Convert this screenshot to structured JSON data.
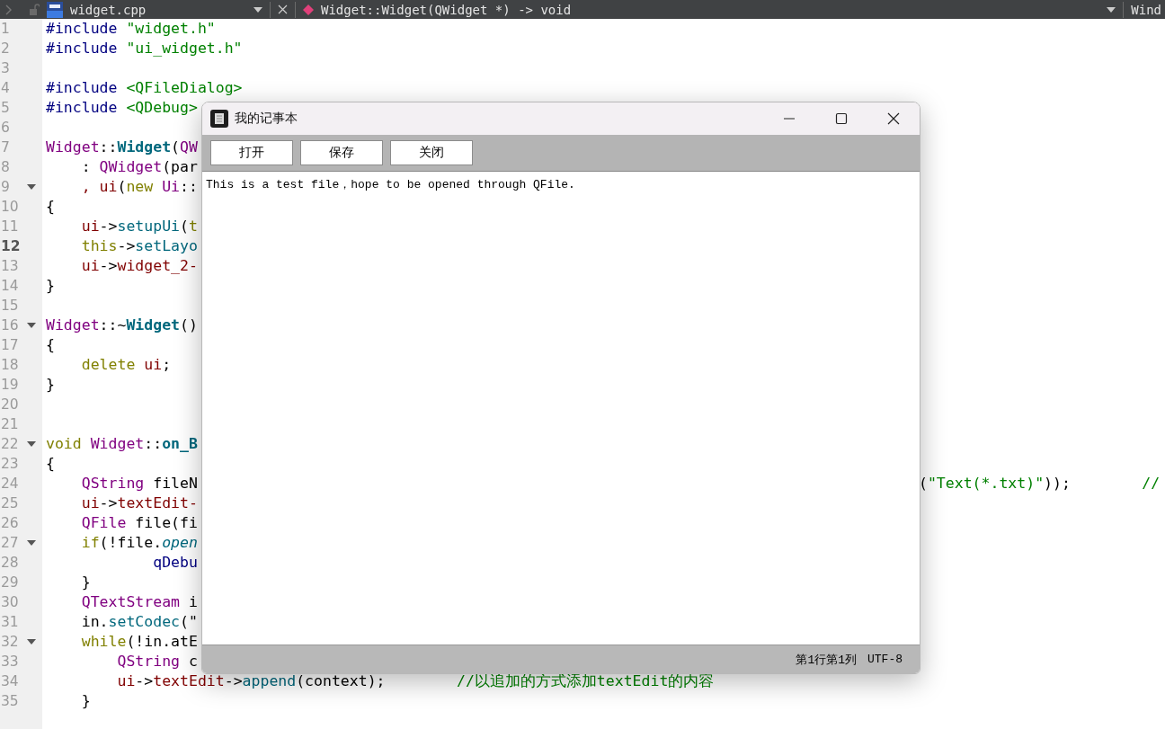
{
  "top_bar": {
    "file_name": "widget.cpp",
    "function": "Widget::Widget(QWidget *) -> void",
    "right_label": "Wind"
  },
  "editor": {
    "lines": [
      {
        "n": "1",
        "current": false,
        "fold": false,
        "code": [
          {
            "s": "#include",
            "color": "#000080"
          },
          {
            "s": " \"widget.h\"",
            "color": "#008000"
          }
        ]
      },
      {
        "n": "2",
        "current": false,
        "fold": false,
        "code": [
          {
            "s": "#include",
            "color": "#000080"
          },
          {
            "s": " \"ui_widget.h\"",
            "color": "#008000"
          }
        ]
      },
      {
        "n": "3",
        "current": false,
        "fold": false
      },
      {
        "n": "4",
        "current": false,
        "fold": false,
        "code": [
          {
            "s": "#include",
            "color": "#000080"
          },
          {
            "s": " <QFileDialog>",
            "color": "#008000"
          }
        ]
      },
      {
        "n": "5",
        "current": false,
        "fold": false,
        "code": [
          {
            "s": "#include",
            "color": "#000080"
          },
          {
            "s": " <QDebug>",
            "color": "#008000"
          }
        ]
      },
      {
        "n": "6",
        "current": false,
        "fold": false
      },
      {
        "n": "7",
        "current": false,
        "fold": false,
        "code": [
          {
            "s": "Widget",
            "color": "#800080"
          },
          {
            "s": "::",
            "color": "#000000"
          },
          {
            "s": "**Widget**",
            "color": "#00677c"
          },
          {
            "s": "(",
            "color": "#000000"
          },
          {
            "s": "QW",
            "color": "#800080"
          }
        ]
      },
      {
        "n": "8",
        "current": false,
        "fold": false,
        "code": [
          {
            "s": "    :",
            "color": "#000000"
          },
          {
            "s": " QWidget",
            "color": "#800080"
          },
          {
            "s": "(par",
            "color": "#000000"
          }
        ]
      },
      {
        "n": "9",
        "current": false,
        "fold": true,
        "code": [
          {
            "s": "    , ui",
            "color": "#800000"
          },
          {
            "s": "(",
            "color": "#000000"
          },
          {
            "s": "new",
            "color": "#808000"
          },
          {
            "s": " Ui",
            "color": "#800080"
          },
          {
            "s": "::",
            "color": "#000000"
          }
        ]
      },
      {
        "n": "10",
        "current": false,
        "fold": false,
        "code": [
          {
            "s": "{",
            "color": "#000000"
          }
        ]
      },
      {
        "n": "11",
        "current": false,
        "fold": false,
        "code": [
          {
            "s": "    ui",
            "color": "#800000"
          },
          {
            "s": "->",
            "color": "#000000"
          },
          {
            "s": "setupUi",
            "color": "#00677c"
          },
          {
            "s": "(",
            "color": "#000000"
          },
          {
            "s": "t",
            "color": "#808000"
          }
        ]
      },
      {
        "n": "12",
        "current": true,
        "fold": false,
        "code": [
          {
            "s": "    this",
            "color": "#808000"
          },
          {
            "s": "->",
            "color": "#000000"
          },
          {
            "s": "setLayo",
            "color": "#00677c"
          }
        ]
      },
      {
        "n": "13",
        "current": false,
        "fold": false,
        "code": [
          {
            "s": "    ui",
            "color": "#800000"
          },
          {
            "s": "->",
            "color": "#000000"
          },
          {
            "s": "widget_2-",
            "color": "#800000"
          }
        ]
      },
      {
        "n": "14",
        "current": false,
        "fold": false,
        "code": [
          {
            "s": "}",
            "color": "#000000"
          }
        ]
      },
      {
        "n": "15",
        "current": false,
        "fold": false
      },
      {
        "n": "16",
        "current": false,
        "fold": true,
        "code": [
          {
            "s": "Widget",
            "color": "#800080"
          },
          {
            "s": "::~",
            "color": "#000000"
          },
          {
            "s": "**Widget**",
            "color": "#00677c"
          },
          {
            "s": "()",
            "color": "#000000"
          }
        ]
      },
      {
        "n": "17",
        "current": false,
        "fold": false,
        "code": [
          {
            "s": "{",
            "color": "#000000"
          }
        ]
      },
      {
        "n": "18",
        "current": false,
        "fold": false,
        "code": [
          {
            "s": "    delete",
            "color": "#808000"
          },
          {
            "s": " ui",
            "color": "#800000"
          },
          {
            "s": ";",
            "color": "#000000"
          }
        ]
      },
      {
        "n": "19",
        "current": false,
        "fold": false,
        "code": [
          {
            "s": "}",
            "color": "#000000"
          }
        ]
      },
      {
        "n": "20",
        "current": false,
        "fold": false
      },
      {
        "n": "21",
        "current": false,
        "fold": false
      },
      {
        "n": "22",
        "current": false,
        "fold": true,
        "code": [
          {
            "s": "void",
            "color": "#808000"
          },
          {
            "s": " Widget",
            "color": "#800080"
          },
          {
            "s": "::",
            "color": "#000000"
          },
          {
            "s": "**on_B**",
            "color": "#00677c"
          }
        ]
      },
      {
        "n": "23",
        "current": false,
        "fold": false,
        "code": [
          {
            "s": "{",
            "color": "#000000"
          }
        ]
      },
      {
        "n": "24",
        "current": false,
        "fold": false,
        "code": [
          {
            "s": "    QString",
            "color": "#800080"
          },
          {
            "s": " fileN",
            "color": "#000000"
          }
        ],
        "code_right": [
          {
            "s": "(",
            "color": "#000000"
          },
          {
            "s": "\"Text(*.txt)\"",
            "color": "#008000"
          },
          {
            "s": "));",
            "color": "#000000"
          },
          {
            "s": "        //",
            "color": "#008000"
          }
        ]
      },
      {
        "n": "25",
        "current": false,
        "fold": false,
        "code": [
          {
            "s": "    ui",
            "color": "#800000"
          },
          {
            "s": "->",
            "color": "#000000"
          },
          {
            "s": "textEdit-",
            "color": "#800000"
          }
        ]
      },
      {
        "n": "26",
        "current": false,
        "fold": false,
        "code": [
          {
            "s": "    QFile",
            "color": "#800080"
          },
          {
            "s": " file(fi",
            "color": "#000000"
          }
        ]
      },
      {
        "n": "27",
        "current": false,
        "fold": true,
        "code": [
          {
            "s": "    if",
            "color": "#808000"
          },
          {
            "s": "(!file.",
            "color": "#000000"
          },
          {
            "s": "*open*",
            "color": "#00677c"
          }
        ]
      },
      {
        "n": "28",
        "current": false,
        "fold": false,
        "code": [
          {
            "s": "            qDebu",
            "color": "#000080"
          }
        ]
      },
      {
        "n": "29",
        "current": false,
        "fold": false,
        "code": [
          {
            "s": "    }",
            "color": "#000000"
          }
        ]
      },
      {
        "n": "30",
        "current": false,
        "fold": false,
        "code": [
          {
            "s": "    QTextStream",
            "color": "#800080"
          },
          {
            "s": " i",
            "color": "#000000"
          }
        ]
      },
      {
        "n": "31",
        "current": false,
        "fold": false,
        "code": [
          {
            "s": "    in.",
            "color": "#000000"
          },
          {
            "s": "setCodec",
            "color": "#00677c"
          },
          {
            "s": "(\"",
            "color": "#000000"
          }
        ]
      },
      {
        "n": "32",
        "current": false,
        "fold": true,
        "code": [
          {
            "s": "    while",
            "color": "#808000"
          },
          {
            "s": "(!in.atE",
            "color": "#000000"
          }
        ]
      },
      {
        "n": "33",
        "current": false,
        "fold": false,
        "code": [
          {
            "s": "        QString",
            "color": "#800080"
          },
          {
            "s": " c",
            "color": "#000000"
          }
        ]
      },
      {
        "n": "34",
        "current": false,
        "fold": false,
        "code": [
          {
            "s": "        ui",
            "color": "#800000"
          },
          {
            "s": "->",
            "color": "#000000"
          },
          {
            "s": "textEdit",
            "color": "#800000"
          },
          {
            "s": "->",
            "color": "#000000"
          },
          {
            "s": "append",
            "color": "#00677c"
          },
          {
            "s": "(context);",
            "color": "#000000"
          },
          {
            "s": "        //以追加的方式添加textEdit的内容",
            "color": "#008000"
          }
        ]
      },
      {
        "n": "35",
        "current": false,
        "fold": false,
        "code": [
          {
            "s": "    }",
            "color": "#000000"
          }
        ]
      }
    ]
  },
  "dialog": {
    "title": "我的记事本",
    "buttons": [
      "打开",
      "保存",
      "关闭"
    ],
    "text": "This is a test file，hope to be opened through QFile.",
    "status": [
      "第1行第1列",
      "UTF-8"
    ]
  }
}
